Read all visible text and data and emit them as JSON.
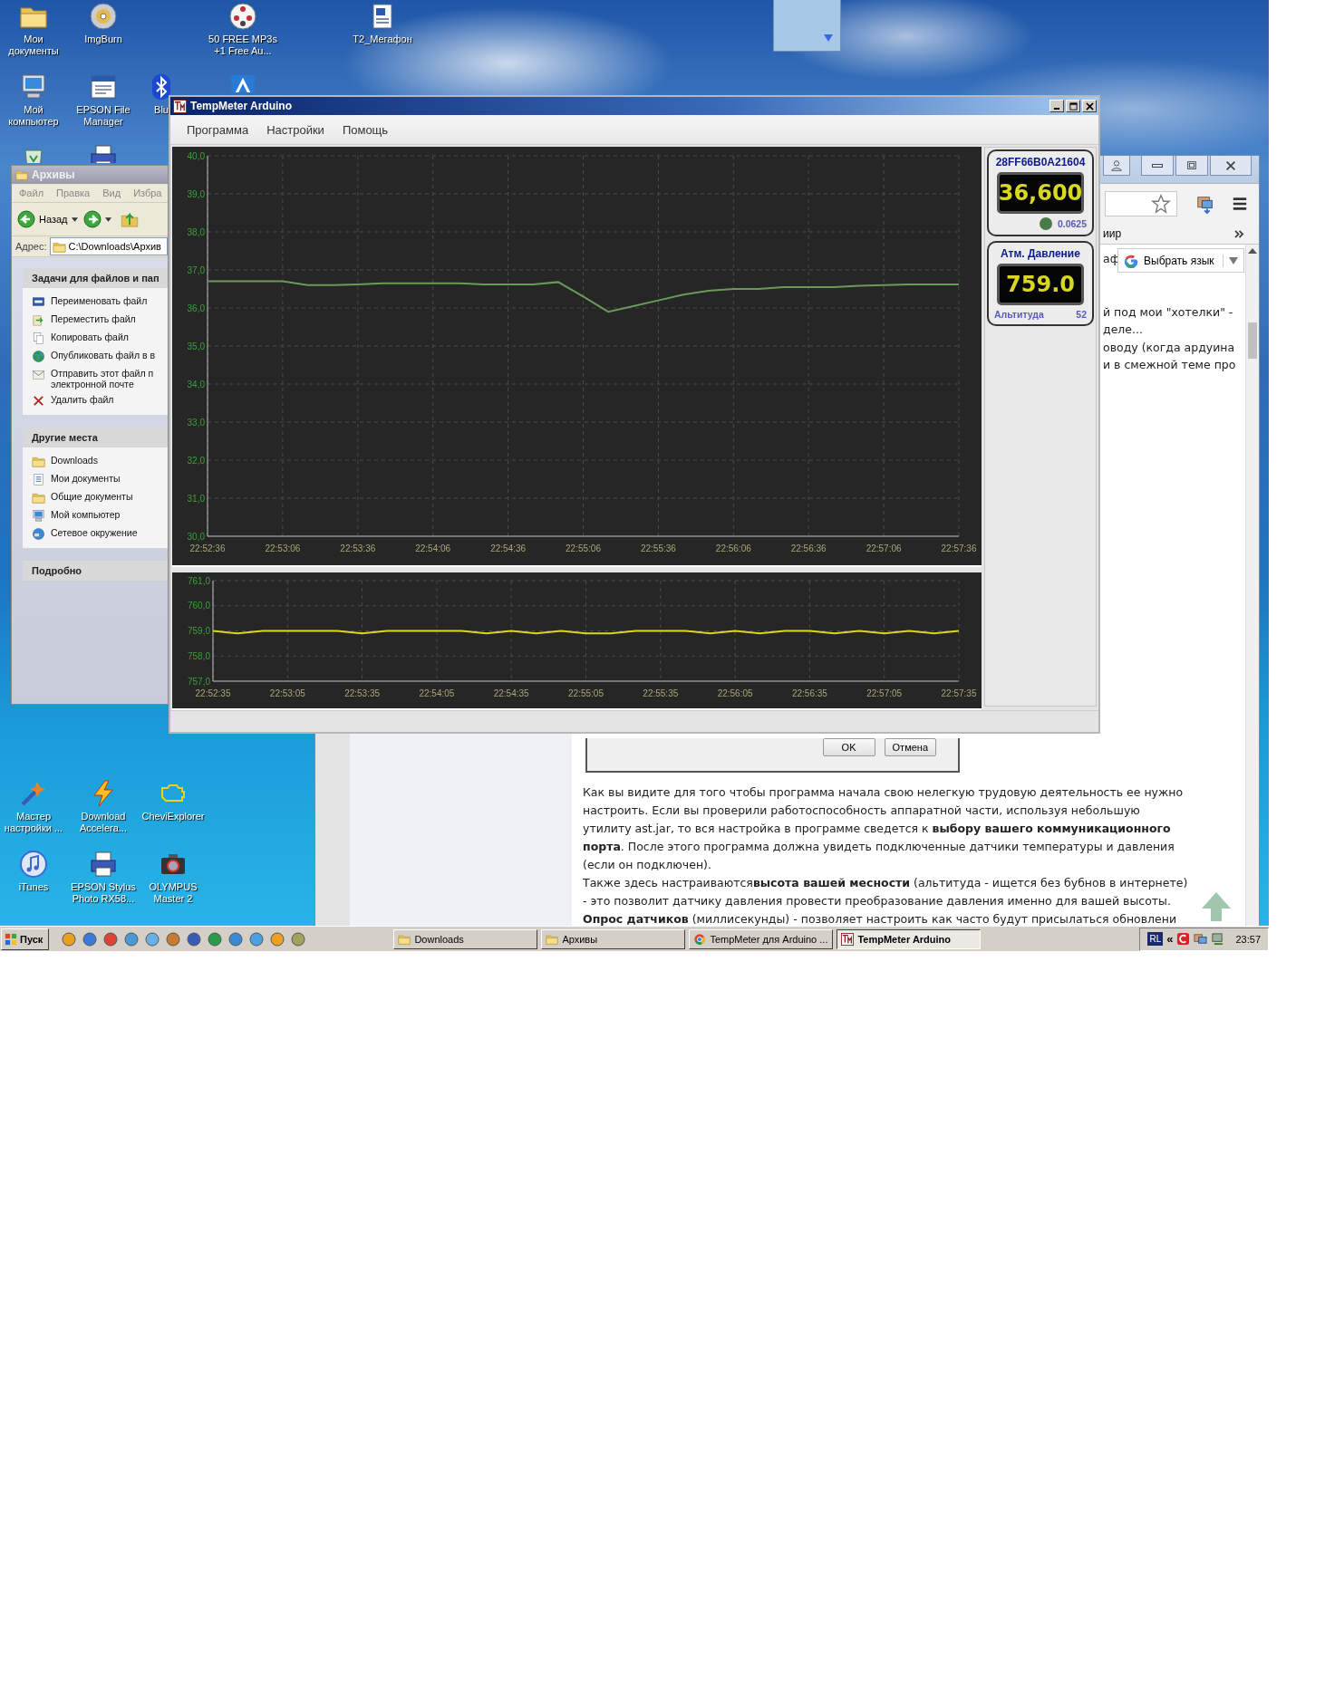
{
  "desktop_icons": [
    {
      "label": "Мои документы",
      "kind": "folder"
    },
    {
      "label": "ImgBurn",
      "kind": "disc"
    },
    {
      "label": "50 FREE MP3s +1 Free Au...",
      "kind": "reel"
    },
    {
      "label": "T2_Мегафон",
      "kind": "document"
    },
    {
      "label": "Мой компьютер",
      "kind": "computer"
    },
    {
      "label": "EPSON File Manager",
      "kind": "window"
    },
    {
      "label": "Blu",
      "kind": "bluetooth"
    },
    {
      "kind": "app"
    },
    {
      "kind": "recycle"
    },
    {
      "kind": "printer"
    },
    {
      "label": "Мастер настройки ...",
      "kind": "wand"
    },
    {
      "label": "Download Accelera...",
      "kind": "lightning"
    },
    {
      "label": "CheviExplorer",
      "kind": "engine"
    },
    {
      "label": "iTunes",
      "kind": "music"
    },
    {
      "label": "EPSON Stylus Photo RX58...",
      "kind": "printer"
    },
    {
      "label": "OLYMPUS Master 2",
      "kind": "camera"
    }
  ],
  "explorer_window": {
    "title": "Архивы",
    "menu": [
      "Файл",
      "Правка",
      "Вид",
      "Избра"
    ],
    "back_label": "Назад",
    "address_label": "Адрес:",
    "address": "C:\\Downloads\\Архив",
    "panels": [
      {
        "title": "Задачи для файлов и пап",
        "items": [
          {
            "label": "Переименовать файл",
            "kind": "rename"
          },
          {
            "label": "Переместить файл",
            "kind": "move"
          },
          {
            "label": "Копировать файл",
            "kind": "copy"
          },
          {
            "label": "Опубликовать файл в в",
            "kind": "publish"
          },
          {
            "label": "Отправить этот файл п электронной почте",
            "kind": "email"
          },
          {
            "label": "Удалить файл",
            "kind": "delete"
          }
        ]
      },
      {
        "title": "Другие места",
        "items": [
          {
            "label": "Downloads",
            "kind": "folder"
          },
          {
            "label": "Мои документы",
            "kind": "documents"
          },
          {
            "label": "Общие документы",
            "kind": "folder"
          },
          {
            "label": "Мой компьютер",
            "kind": "computer"
          },
          {
            "label": "Сетевое окружение",
            "kind": "network"
          }
        ]
      },
      {
        "title": "Подробно"
      }
    ]
  },
  "browser": {
    "bookmark": "иир",
    "fragment": "аф",
    "side_lines": [
      "й под мои \"хотелки\" -",
      "деле...",
      "оводу (когда ардуина",
      "и в смежной теме про"
    ],
    "translate_label": "Выбрать язык",
    "dialog_buttons": [
      "OK",
      "Отмена"
    ],
    "article_lines": [
      "Как вы видите для того чтобы программа начала свою нелегкую трудовую деятельность ее нужно",
      "настроить. Если вы проверили работоспособность аппаратной части, используя небольшую",
      "утилиту ast.jar, то вся настройка в программе сведется к **выбору вашего коммуникационного**",
      "**порта**. После этого программа должна увидеть подключенные датчики температуры и давления",
      "(если он подключен).",
      "Также здесь настраиваются**высота вашей месности** (альтитуда - ищется без бубнов в интернете)",
      "- это позволит датчику давления провести преобразование давления именно для вашей высоты.",
      "**Опрос датчиков** (миллисекунды) - позволяет настроить как часто будут присылаться обновлени"
    ]
  },
  "app_window": {
    "title": "TempMeter Arduino",
    "menu": [
      "Программа",
      "Настройки",
      "Помощь"
    ],
    "temperature_chart": {
      "chart_data": {
        "type": "line",
        "grid": true,
        "ylim": [
          30,
          40
        ],
        "categories": [
          "22:52:36",
          null,
          null,
          "22:53:06",
          null,
          null,
          "22:53:36",
          null,
          null,
          "22:54:06",
          null,
          null,
          "22:54:36",
          null,
          null,
          "22:55:06",
          null,
          null,
          "22:55:36",
          null,
          null,
          "22:56:06",
          null,
          null,
          "22:56:36",
          null,
          null,
          "22:57:06",
          null,
          null,
          "22:57:36"
        ],
        "values": [
          36.7,
          36.7,
          36.7,
          36.7,
          36.6,
          36.6,
          36.62,
          36.65,
          36.65,
          36.65,
          36.65,
          36.62,
          36.62,
          36.62,
          36.68,
          36.3,
          35.9,
          36.05,
          36.2,
          36.35,
          36.45,
          36.5,
          36.5,
          36.55,
          36.55,
          36.55,
          36.58,
          36.6,
          36.62,
          36.62,
          36.62
        ],
        "yticks": [
          {
            "value": 30,
            "label": "30,0"
          },
          {
            "value": 31,
            "label": "31,0"
          },
          {
            "value": 32,
            "label": "32,0"
          },
          {
            "value": 33,
            "label": "33,0"
          },
          {
            "value": 34,
            "label": "34,0"
          },
          {
            "value": 35,
            "label": "35,0"
          },
          {
            "value": 36,
            "label": "36,0"
          },
          {
            "value": 37,
            "label": "37,0"
          },
          {
            "value": 38,
            "label": "38,0"
          },
          {
            "value": 39,
            "label": "39,0"
          },
          {
            "value": 40,
            "label": "40,0"
          }
        ]
      }
    },
    "pressure_chart": {
      "chart_data": {
        "type": "line",
        "grid": true,
        "ylim": [
          757,
          761
        ],
        "categories": [
          "22:52:35",
          null,
          null,
          "22:53:05",
          null,
          null,
          "22:53:35",
          null,
          null,
          "22:54:05",
          null,
          null,
          "22:54:35",
          null,
          null,
          "22:55:05",
          null,
          null,
          "22:55:35",
          null,
          null,
          "22:56:05",
          null,
          null,
          "22:56:35",
          null,
          null,
          "22:57:05",
          null,
          null,
          "22:57:35"
        ],
        "values": [
          759,
          758.9,
          759,
          759,
          759,
          759,
          758.9,
          759,
          759,
          759,
          759,
          758.9,
          759,
          758.9,
          759,
          758.9,
          758.9,
          759,
          759,
          759,
          758.9,
          759,
          758.9,
          759,
          759,
          758.9,
          759,
          758.9,
          759,
          758.9,
          759
        ],
        "yticks": [
          {
            "value": 757,
            "label": "757,0"
          },
          {
            "value": 758,
            "label": "758,0"
          },
          {
            "value": 759,
            "label": "759,0"
          },
          {
            "value": 760,
            "label": "760,0"
          },
          {
            "value": 761,
            "label": "761,0"
          }
        ]
      }
    },
    "sensors": [
      {
        "kind": "temperature",
        "title": "28FF66B0A21604",
        "reading": "36,600",
        "resolution": "0.0625"
      },
      {
        "kind": "pressure",
        "title": "Атм. Давление",
        "reading": "759.0",
        "altitude_label": "Альтитуда",
        "altitude": "52"
      }
    ]
  },
  "taskbar": {
    "start": "Пуск",
    "tasks": [
      {
        "label": "Downloads",
        "kind": "folder",
        "selected": false
      },
      {
        "label": "Архивы",
        "kind": "folder",
        "selected": false
      },
      {
        "label": "TempMeter для Arduino ...",
        "kind": "browser",
        "selected": false
      },
      {
        "label": "TempMeter Arduino",
        "kind": "app",
        "selected": true
      }
    ],
    "lang": "RL",
    "chevron": "«",
    "clock": "23:57"
  }
}
